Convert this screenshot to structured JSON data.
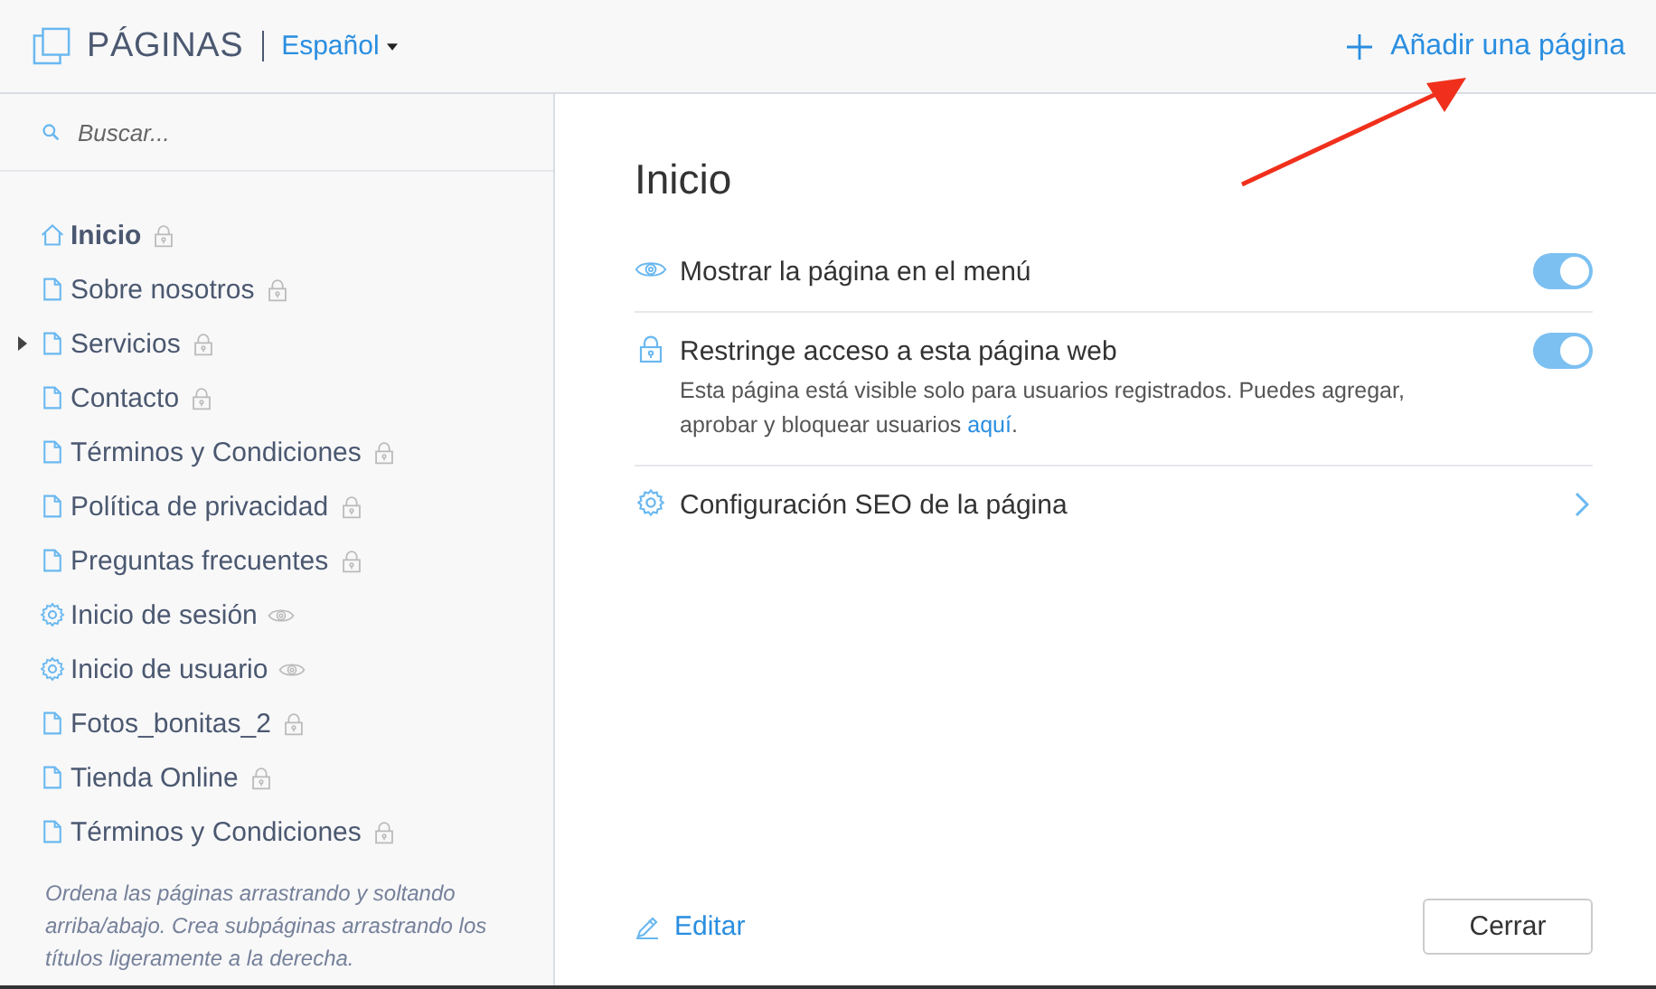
{
  "header": {
    "title": "PÁGINAS",
    "language": "Español",
    "add_button": "Añadir una página"
  },
  "search": {
    "placeholder": "Buscar..."
  },
  "pages": [
    {
      "label": "Inicio",
      "kind": "home",
      "selected": true,
      "has_children": false
    },
    {
      "label": "Sobre nosotros",
      "kind": "page",
      "selected": false,
      "has_children": false
    },
    {
      "label": "Servicios",
      "kind": "page",
      "selected": false,
      "has_children": true
    },
    {
      "label": "Contacto",
      "kind": "page",
      "selected": false,
      "has_children": false
    },
    {
      "label": "Términos y Condiciones",
      "kind": "page",
      "selected": false,
      "has_children": false
    },
    {
      "label": "Política de privacidad",
      "kind": "page",
      "selected": false,
      "has_children": false
    },
    {
      "label": "Preguntas frecuentes",
      "kind": "page",
      "selected": false,
      "has_children": false
    },
    {
      "label": "Inicio de sesión",
      "kind": "system",
      "selected": false,
      "has_children": false
    },
    {
      "label": "Inicio de usuario",
      "kind": "system",
      "selected": false,
      "has_children": false
    },
    {
      "label": "Fotos_bonitas_2",
      "kind": "page",
      "selected": false,
      "has_children": false
    },
    {
      "label": "Tienda Online",
      "kind": "page",
      "selected": false,
      "has_children": false
    },
    {
      "label": "Términos y Condiciones",
      "kind": "page",
      "selected": false,
      "has_children": false
    }
  ],
  "sidebar_hint": "Ordena las páginas arrastrando y soltando arriba/abajo. Crea subpáginas arrastrando los títulos ligeramente a la derecha.",
  "detail": {
    "title": "Inicio",
    "settings": [
      {
        "kind": "menu_visibility",
        "label": "Mostrar la página en el menú",
        "on": true
      },
      {
        "kind": "access",
        "label": "Restringe acceso a esta página web",
        "on": true,
        "description": "Esta página está visible solo para usuarios registrados. Puedes agregar, aprobar y bloquear usuarios ",
        "link": "aquí",
        "after_link": "."
      },
      {
        "kind": "seo",
        "label": "Configuración SEO de la página"
      }
    ],
    "edit_link": "Editar",
    "close_button": "Cerrar"
  }
}
